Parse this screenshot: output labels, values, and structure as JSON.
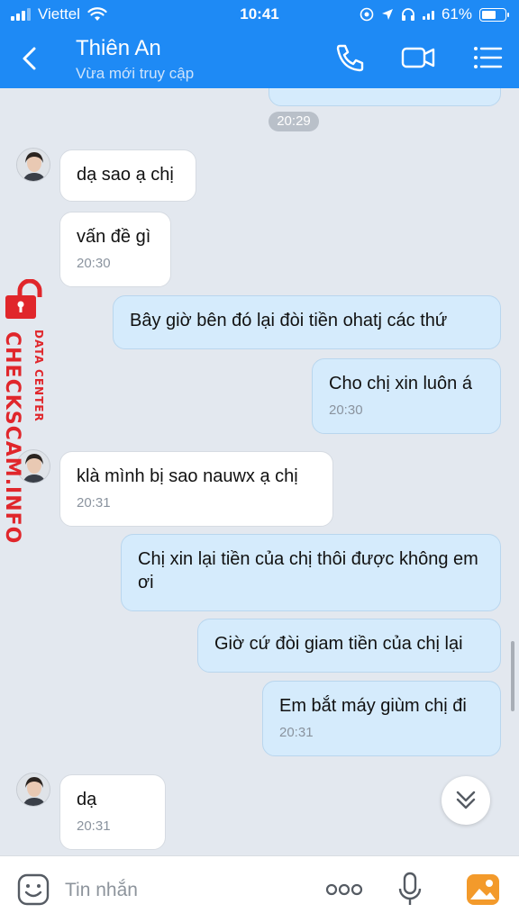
{
  "status_bar": {
    "carrier": "Viettel",
    "time": "10:41",
    "battery": "61%",
    "battery_level": 0.61
  },
  "header": {
    "title": "Thiên An",
    "subtitle": "Vừa mới truy cập"
  },
  "chat": {
    "date_chip": "20:29",
    "messages": [
      {
        "text": "dạ sao ạ chị"
      },
      {
        "text": "vấn đề gì",
        "time": "20:30"
      },
      {
        "text": "Bây giờ bên đó lại đòi tiền ohatj các thứ"
      },
      {
        "text": "Cho chị xin luôn á",
        "time": "20:30"
      },
      {
        "text": "klà mình bị sao nauwx ạ chị",
        "time": "20:31"
      },
      {
        "text": "Chị xin lại tiền của chị thôi được không em ơi"
      },
      {
        "text": "Giờ cứ đòi giam tiền của chị lại"
      },
      {
        "text": "Em bắt máy giùm chị đi",
        "time": "20:31"
      },
      {
        "text": "dạ",
        "time": "20:31"
      }
    ]
  },
  "watermark": {
    "brand": "CHECKSCAM.INFO",
    "sub": "DATA CENTER"
  },
  "input_bar": {
    "placeholder": "Tin nhắn"
  },
  "colors": {
    "header_bg": "#1e8af5",
    "incoming_bubble": "#ffffff",
    "outgoing_bubble": "#d5ebfc",
    "watermark": "#e0262b"
  }
}
